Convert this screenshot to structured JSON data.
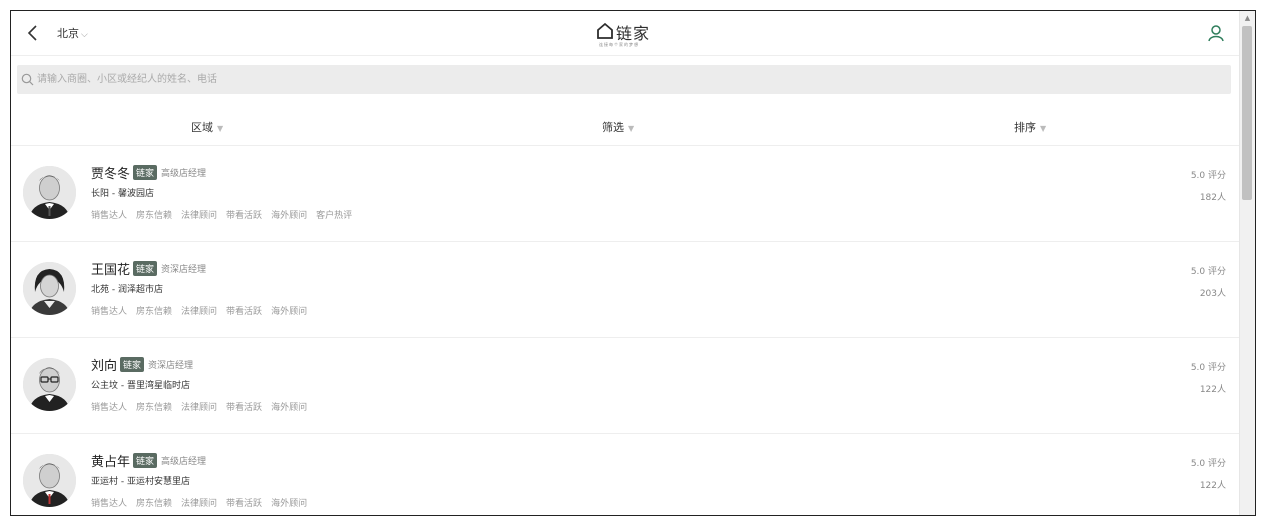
{
  "header": {
    "city": "北京",
    "logo_text": "链家",
    "logo_sub": "连接每个家的梦想"
  },
  "search": {
    "placeholder": "请输入商圈、小区或经纪人的姓名、电话"
  },
  "filters": [
    {
      "label": "区域"
    },
    {
      "label": "筛选"
    },
    {
      "label": "排序"
    }
  ],
  "agents": [
    {
      "name": "贾冬冬",
      "badge": "链家",
      "title": "高级店经理",
      "store": "长阳 - 馨波园店",
      "tags": [
        "销售达人",
        "房东信赖",
        "法律顾问",
        "带看活跃",
        "海外顾问",
        "客户热评"
      ],
      "rating": "5.0 评分",
      "count": "182人"
    },
    {
      "name": "王国花",
      "badge": "链家",
      "title": "资深店经理",
      "store": "北苑 - 润泽超市店",
      "tags": [
        "销售达人",
        "房东信赖",
        "法律顾问",
        "带看活跃",
        "海外顾问"
      ],
      "rating": "5.0 评分",
      "count": "203人"
    },
    {
      "name": "刘向",
      "badge": "链家",
      "title": "资深店经理",
      "store": "公主坟 - 晋里湾星临时店",
      "tags": [
        "销售达人",
        "房东信赖",
        "法律顾问",
        "带看活跃",
        "海外顾问"
      ],
      "rating": "5.0 评分",
      "count": "122人"
    },
    {
      "name": "黄占年",
      "badge": "链家",
      "title": "高级店经理",
      "store": "亚运村 - 亚运村安慧里店",
      "tags": [
        "销售达人",
        "房东信赖",
        "法律顾问",
        "带看活跃",
        "海外顾问"
      ],
      "rating": "5.0 评分",
      "count": "122人"
    }
  ],
  "colors": {
    "accent": "#2e7d5b",
    "badge_bg": "#5a6b62"
  }
}
